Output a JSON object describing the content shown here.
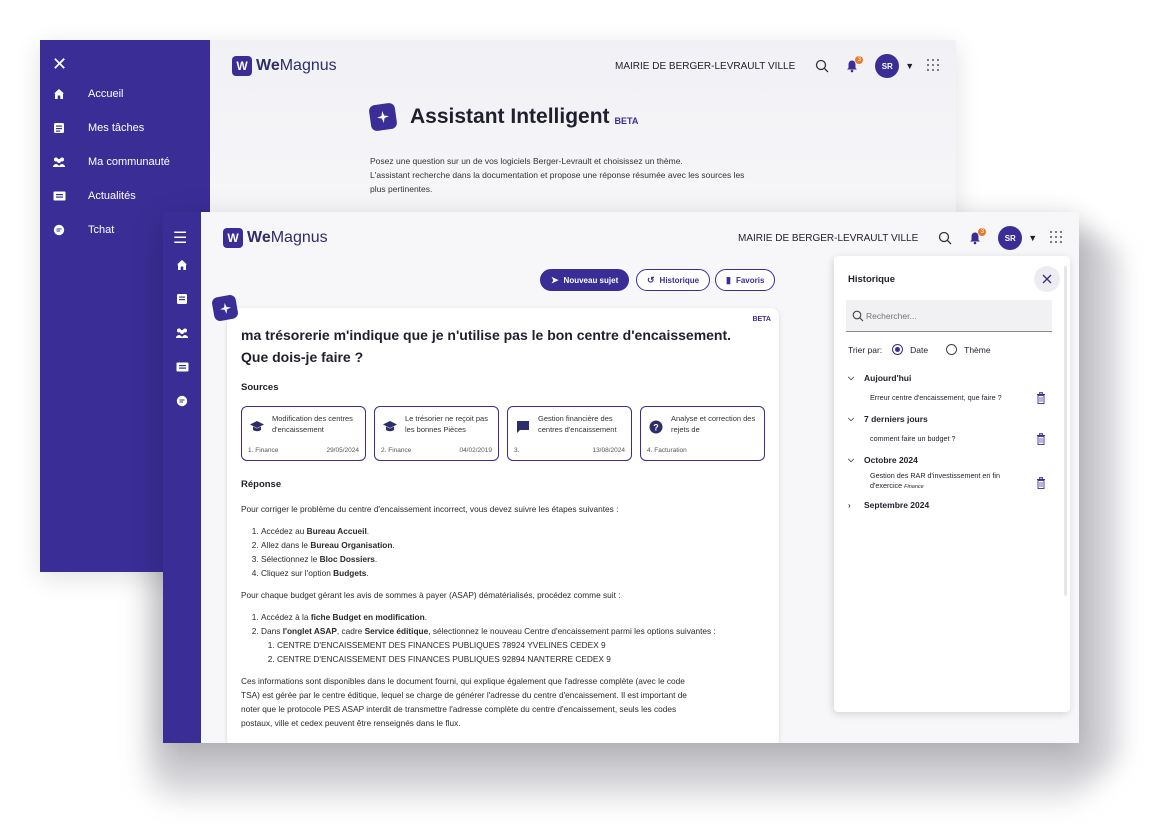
{
  "back": {
    "brand_bold": "We",
    "brand_rest": "Magnus",
    "mairie": "MAIRIE DE BERGER-LEVRAULT VILLE",
    "avatar": "SR",
    "notif_count": "3",
    "nav": [
      {
        "label": "Accueil",
        "icon": "home-icon"
      },
      {
        "label": "Mes tâches",
        "icon": "tasks-icon"
      },
      {
        "label": "Ma communauté",
        "icon": "community-icon"
      },
      {
        "label": "Actualités",
        "icon": "news-icon"
      },
      {
        "label": "Tchat",
        "icon": "chat-icon"
      }
    ],
    "assistant_title": "Assistant Intelligent",
    "beta": "BETA",
    "intro_lines": [
      "Posez une question sur un de vos logiciels Berger-Levrault et choisissez un thème.",
      "L'assistant recherche dans la documentation et propose une réponse résumée avec les sources les",
      "plus pertinentes."
    ]
  },
  "front": {
    "brand_bold": "We",
    "brand_rest": "Magnus",
    "mairie": "MAIRIE DE BERGER-LEVRAULT VILLE",
    "avatar": "SR",
    "notif_count": "3",
    "buttons": {
      "new_topic": "Nouveau sujet",
      "history": "Historique",
      "favorites": "Favoris"
    },
    "chat": {
      "beta": "BETA",
      "question": "ma trésorerie m'indique que je n'utilise pas le bon centre d'encaissement. Que dois-je faire ?",
      "sources_title": "Sources",
      "sources": [
        {
          "title": "Modification des centres d'encaissement",
          "category": "1. Finance",
          "date": "29/05/2024",
          "icon": "graduation-cap-icon"
        },
        {
          "title": "Le trésorier ne reçoit pas les bonnes Pièces",
          "category": "2. Finance",
          "date": "04/02/2019",
          "icon": "graduation-cap-icon"
        },
        {
          "title": "Gestion financière des centres d'encaissement",
          "category": "3.",
          "date": "13/08/2024",
          "icon": "comment-icon"
        },
        {
          "title": "Analyse et correction des rejets de",
          "category": "4. Facturation",
          "date": "",
          "icon": "help-icon"
        }
      ],
      "response_title": "Réponse",
      "intro": "Pour corriger le problème du centre d'encaissement incorrect, vous devez suivre les étapes suivantes :",
      "steps": [
        {
          "pre": "Accédez au ",
          "bold": "Bureau Accueil",
          "post": "."
        },
        {
          "pre": "Allez dans le ",
          "bold": "Bureau Organisation",
          "post": "."
        },
        {
          "pre": "Sélectionnez le ",
          "bold": "Bloc Dossiers",
          "post": "."
        },
        {
          "pre": "Cliquez sur l'option ",
          "bold": "Budgets",
          "post": "."
        }
      ],
      "intro2": "Pour chaque budget gérant les avis de sommes à payer (ASAP) dématérialisés, procédez comme suit :",
      "steps2_1_pre": "Accédez à la ",
      "steps2_1_bold": "fiche Budget en modification",
      "steps2_1_post": ".",
      "steps2_2_pre": "Dans ",
      "steps2_2_bold1": "l'onglet ASAP",
      "steps2_2_mid": ", cadre ",
      "steps2_2_bold2": "Service éditique",
      "steps2_2_post": ", sélectionnez le nouveau Centre d'encaissement parmi les options suivantes :",
      "options": [
        "CENTRE D'ENCAISSEMENT DES FINANCES PUBLIQUES 78924 YVELINES CEDEX 9",
        "CENTRE D'ENCAISSEMENT DES FINANCES PUBLIQUES 92894 NANTERRE CEDEX 9"
      ],
      "closing_lines": [
        "Ces informations sont disponibles dans le document fourni, qui explique également que l'adresse complète (avec le code",
        "TSA) est gérée par le centre éditique, lequel se charge de générer l'adresse du centre d'encaissement. Il est important de",
        "noter que le protocole PES ASAP interdit de transmettre l'adresse complète du centre d'encaissement, seuls les codes",
        "postaux, ville et cedex peuvent être renseignés dans le flux."
      ]
    },
    "history": {
      "title": "Historique",
      "search_placeholder": "Rechercher...",
      "sort_label": "Trier par:",
      "sort_date": "Date",
      "sort_theme": "Thème",
      "groups": [
        {
          "label": "Aujourd'hui",
          "items": [
            {
              "text": "Erreur centre d'encaissement, que faire ?",
              "tag": ""
            }
          ]
        },
        {
          "label": "7 derniers jours",
          "items": [
            {
              "text": "comment faire un budget ?",
              "tag": ""
            }
          ]
        },
        {
          "label": "Octobre 2024",
          "items": [
            {
              "text": "Gestion des RAR d'investissement en fin d'exercice",
              "tag": "Finance"
            }
          ]
        },
        {
          "label": "Septembre 2024",
          "items": []
        }
      ]
    }
  },
  "colors": {
    "brand": "#3a2d96",
    "accent_badge": "#e8792b"
  }
}
